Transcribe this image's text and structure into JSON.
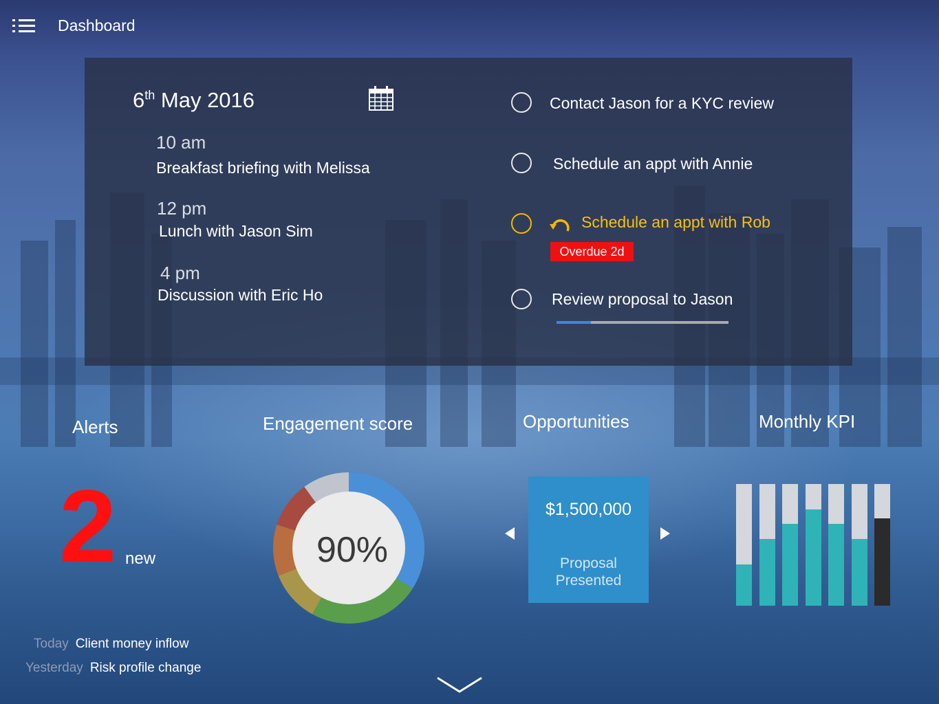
{
  "header": {
    "title": "Dashboard",
    "menu_icon": "list-menu-icon"
  },
  "agenda": {
    "date_day": "6",
    "date_suffix": "th",
    "date_rest": "May 2016",
    "calendar_icon": "calendar-icon",
    "events": [
      {
        "time": "10 am",
        "title": "Breakfast briefing with Melissa"
      },
      {
        "time": "12 pm",
        "title": "Lunch with Jason Sim"
      },
      {
        "time": "4 pm",
        "title": "Discussion with Eric Ho"
      }
    ]
  },
  "tasks": {
    "items": [
      {
        "label": "Contact Jason for a KYC review",
        "status": "open"
      },
      {
        "label": "Schedule an appt with Annie",
        "status": "open"
      },
      {
        "label": "Schedule an appt with Rob",
        "status": "overdue",
        "badge": "Overdue 2d",
        "icon": "undo-arrow-icon"
      },
      {
        "label": "Review proposal to Jason",
        "status": "open"
      }
    ],
    "progress_fraction": 0.2,
    "colors": {
      "warn": "#f8bf17",
      "overdue_badge": "#ee1111",
      "progress": "#3d86e6"
    }
  },
  "alerts": {
    "title": "Alerts",
    "count": "2",
    "count_label": "new",
    "items": [
      {
        "day": "Today",
        "text": "Client money inflow"
      },
      {
        "day": "Yesterday",
        "text": "Risk profile change"
      }
    ]
  },
  "engagement": {
    "title": "Engagement score",
    "value": "90%",
    "segments": [
      {
        "fraction": 0.34,
        "color": "#4a90d9"
      },
      {
        "fraction": 0.24,
        "color": "#5a9e4c"
      },
      {
        "fraction": 0.11,
        "color": "#a8974a"
      },
      {
        "fraction": 0.11,
        "color": "#b86e3e"
      },
      {
        "fraction": 0.1,
        "color": "#a84a40"
      },
      {
        "fraction": 0.1,
        "color": "#c0c4cc"
      }
    ]
  },
  "opportunities": {
    "title": "Opportunities",
    "amount": "$1,500,000",
    "stage_line1": "Proposal",
    "stage_line2": "Presented"
  },
  "kpi": {
    "title": "Monthly KPI",
    "bars": [
      0.34,
      0.55,
      0.67,
      0.79,
      0.67,
      0.55,
      0.72
    ],
    "colors": {
      "fill": "#2fb3b7",
      "highlight": "#2b2b2b",
      "track": "#d4d7dc"
    }
  },
  "footer": {
    "more_icon": "chevron-down-icon"
  }
}
